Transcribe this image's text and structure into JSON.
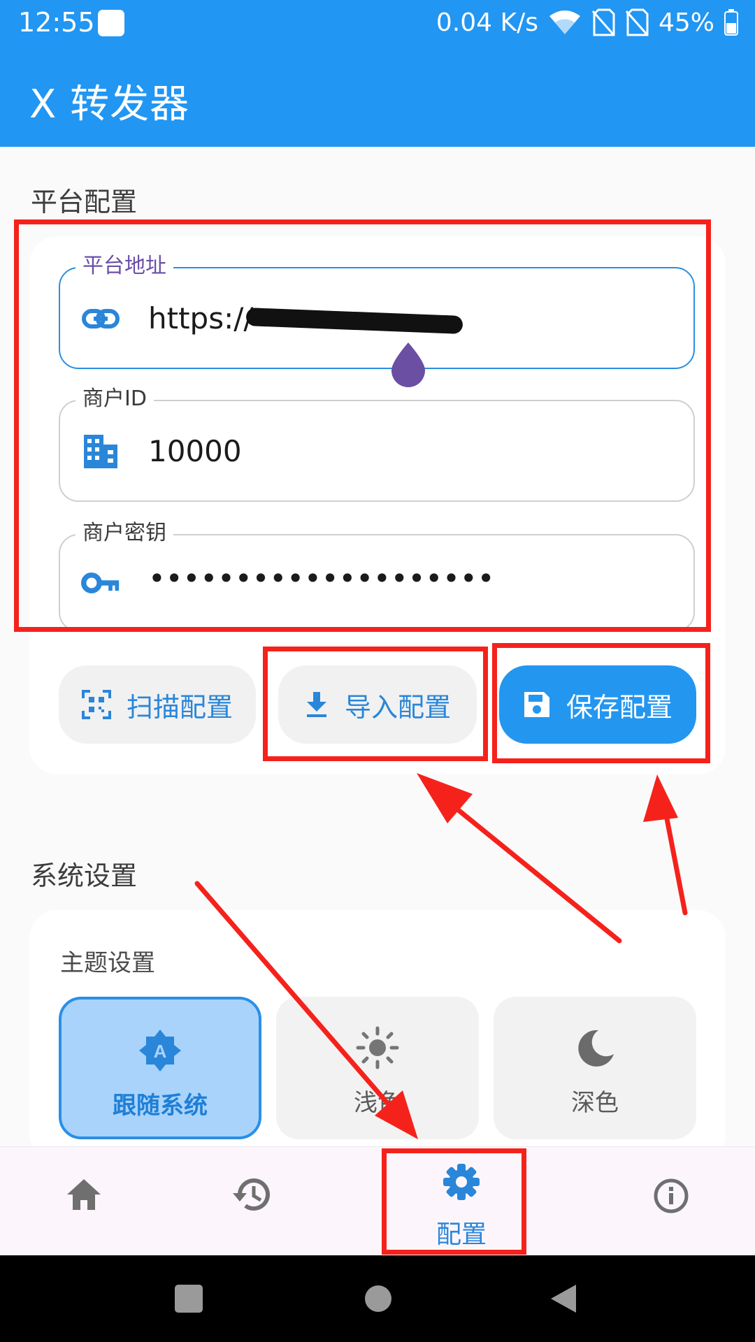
{
  "status_bar": {
    "time": "12:55",
    "net_speed": "0.04 K/s",
    "battery": "45%"
  },
  "app": {
    "title": "X 转发器"
  },
  "platform_section": {
    "title": "平台配置",
    "fields": [
      {
        "label": "平台地址",
        "value": "https://",
        "icon": "link-icon"
      },
      {
        "label": "商户ID",
        "value": "10000",
        "icon": "building-icon"
      },
      {
        "label": "商户密钥",
        "value": "••••••••••••••••••••",
        "icon": "key-icon"
      }
    ],
    "buttons": {
      "scan": "扫描配置",
      "import": "导入配置",
      "save": "保存配置"
    }
  },
  "system_section": {
    "title": "系统设置",
    "theme_title": "主题设置",
    "theme_options": [
      "跟随系统",
      "浅色",
      "深色"
    ],
    "selected_theme": "跟随系统"
  },
  "bottom_nav": {
    "items": [
      "home-icon",
      "history-icon",
      "settings-icon",
      "info-icon"
    ],
    "active_label": "配置"
  },
  "colors": {
    "primary": "#2196f3",
    "annotation": "#f5221c",
    "selected_bg": "#a9d3fb"
  }
}
